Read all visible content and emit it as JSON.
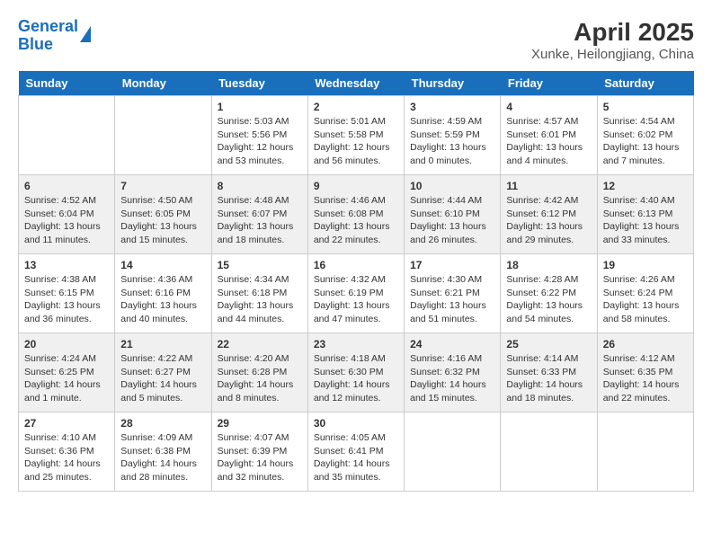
{
  "header": {
    "logo_line1": "General",
    "logo_line2": "Blue",
    "month": "April 2025",
    "location": "Xunke, Heilongjiang, China"
  },
  "days": [
    "Sunday",
    "Monday",
    "Tuesday",
    "Wednesday",
    "Thursday",
    "Friday",
    "Saturday"
  ],
  "rows": [
    [
      {
        "num": "",
        "info": ""
      },
      {
        "num": "",
        "info": ""
      },
      {
        "num": "1",
        "info": "Sunrise: 5:03 AM\nSunset: 5:56 PM\nDaylight: 12 hours and 53 minutes."
      },
      {
        "num": "2",
        "info": "Sunrise: 5:01 AM\nSunset: 5:58 PM\nDaylight: 12 hours and 56 minutes."
      },
      {
        "num": "3",
        "info": "Sunrise: 4:59 AM\nSunset: 5:59 PM\nDaylight: 13 hours and 0 minutes."
      },
      {
        "num": "4",
        "info": "Sunrise: 4:57 AM\nSunset: 6:01 PM\nDaylight: 13 hours and 4 minutes."
      },
      {
        "num": "5",
        "info": "Sunrise: 4:54 AM\nSunset: 6:02 PM\nDaylight: 13 hours and 7 minutes."
      }
    ],
    [
      {
        "num": "6",
        "info": "Sunrise: 4:52 AM\nSunset: 6:04 PM\nDaylight: 13 hours and 11 minutes."
      },
      {
        "num": "7",
        "info": "Sunrise: 4:50 AM\nSunset: 6:05 PM\nDaylight: 13 hours and 15 minutes."
      },
      {
        "num": "8",
        "info": "Sunrise: 4:48 AM\nSunset: 6:07 PM\nDaylight: 13 hours and 18 minutes."
      },
      {
        "num": "9",
        "info": "Sunrise: 4:46 AM\nSunset: 6:08 PM\nDaylight: 13 hours and 22 minutes."
      },
      {
        "num": "10",
        "info": "Sunrise: 4:44 AM\nSunset: 6:10 PM\nDaylight: 13 hours and 26 minutes."
      },
      {
        "num": "11",
        "info": "Sunrise: 4:42 AM\nSunset: 6:12 PM\nDaylight: 13 hours and 29 minutes."
      },
      {
        "num": "12",
        "info": "Sunrise: 4:40 AM\nSunset: 6:13 PM\nDaylight: 13 hours and 33 minutes."
      }
    ],
    [
      {
        "num": "13",
        "info": "Sunrise: 4:38 AM\nSunset: 6:15 PM\nDaylight: 13 hours and 36 minutes."
      },
      {
        "num": "14",
        "info": "Sunrise: 4:36 AM\nSunset: 6:16 PM\nDaylight: 13 hours and 40 minutes."
      },
      {
        "num": "15",
        "info": "Sunrise: 4:34 AM\nSunset: 6:18 PM\nDaylight: 13 hours and 44 minutes."
      },
      {
        "num": "16",
        "info": "Sunrise: 4:32 AM\nSunset: 6:19 PM\nDaylight: 13 hours and 47 minutes."
      },
      {
        "num": "17",
        "info": "Sunrise: 4:30 AM\nSunset: 6:21 PM\nDaylight: 13 hours and 51 minutes."
      },
      {
        "num": "18",
        "info": "Sunrise: 4:28 AM\nSunset: 6:22 PM\nDaylight: 13 hours and 54 minutes."
      },
      {
        "num": "19",
        "info": "Sunrise: 4:26 AM\nSunset: 6:24 PM\nDaylight: 13 hours and 58 minutes."
      }
    ],
    [
      {
        "num": "20",
        "info": "Sunrise: 4:24 AM\nSunset: 6:25 PM\nDaylight: 14 hours and 1 minute."
      },
      {
        "num": "21",
        "info": "Sunrise: 4:22 AM\nSunset: 6:27 PM\nDaylight: 14 hours and 5 minutes."
      },
      {
        "num": "22",
        "info": "Sunrise: 4:20 AM\nSunset: 6:28 PM\nDaylight: 14 hours and 8 minutes."
      },
      {
        "num": "23",
        "info": "Sunrise: 4:18 AM\nSunset: 6:30 PM\nDaylight: 14 hours and 12 minutes."
      },
      {
        "num": "24",
        "info": "Sunrise: 4:16 AM\nSunset: 6:32 PM\nDaylight: 14 hours and 15 minutes."
      },
      {
        "num": "25",
        "info": "Sunrise: 4:14 AM\nSunset: 6:33 PM\nDaylight: 14 hours and 18 minutes."
      },
      {
        "num": "26",
        "info": "Sunrise: 4:12 AM\nSunset: 6:35 PM\nDaylight: 14 hours and 22 minutes."
      }
    ],
    [
      {
        "num": "27",
        "info": "Sunrise: 4:10 AM\nSunset: 6:36 PM\nDaylight: 14 hours and 25 minutes."
      },
      {
        "num": "28",
        "info": "Sunrise: 4:09 AM\nSunset: 6:38 PM\nDaylight: 14 hours and 28 minutes."
      },
      {
        "num": "29",
        "info": "Sunrise: 4:07 AM\nSunset: 6:39 PM\nDaylight: 14 hours and 32 minutes."
      },
      {
        "num": "30",
        "info": "Sunrise: 4:05 AM\nSunset: 6:41 PM\nDaylight: 14 hours and 35 minutes."
      },
      {
        "num": "",
        "info": ""
      },
      {
        "num": "",
        "info": ""
      },
      {
        "num": "",
        "info": ""
      }
    ]
  ]
}
